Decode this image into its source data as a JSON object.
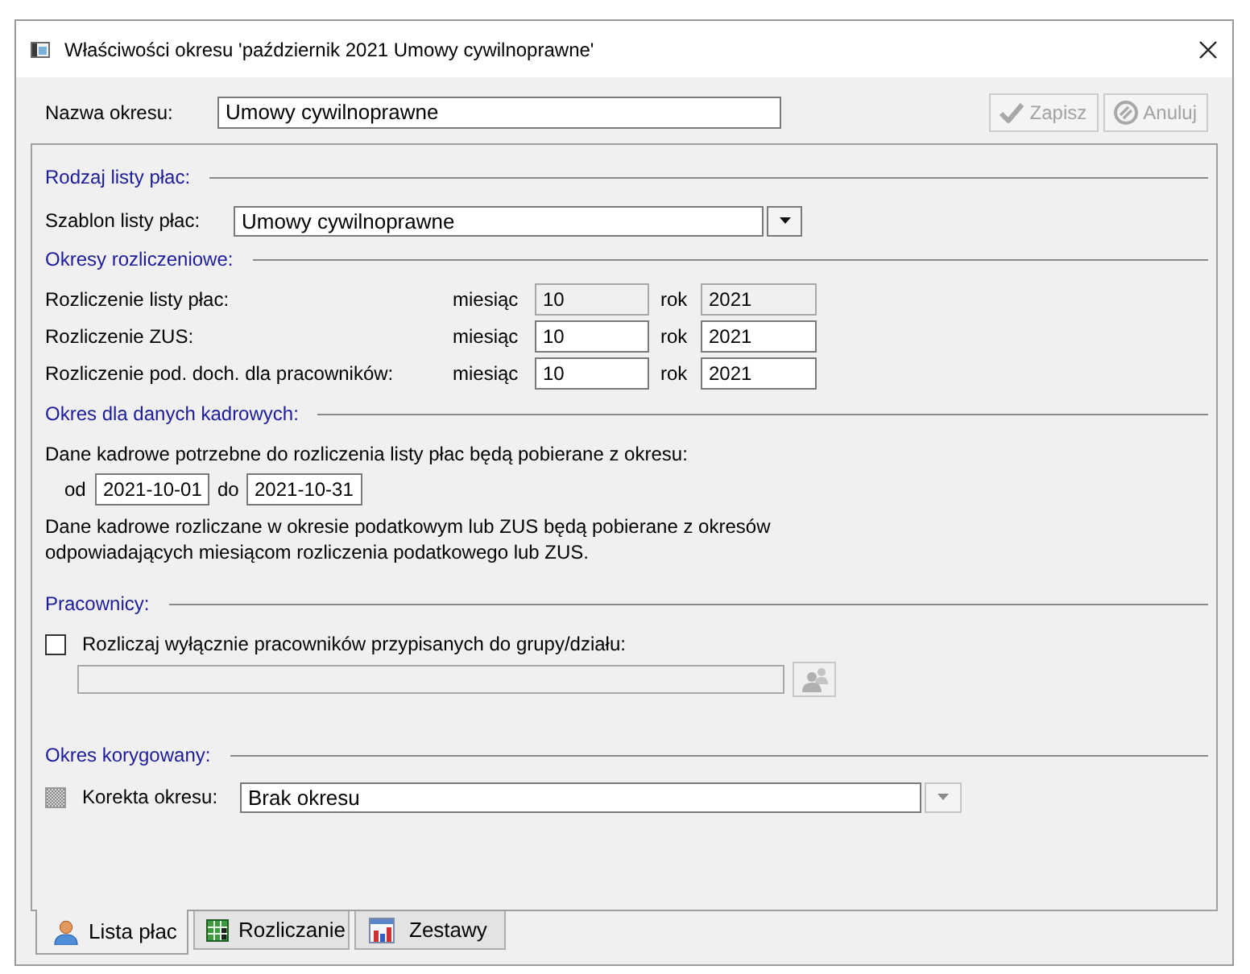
{
  "window": {
    "title": "Właściwości okresu 'październik 2021 Umowy cywilnoprawne'"
  },
  "header": {
    "name_label": "Nazwa okresu:",
    "name_value": "Umowy cywilnoprawne",
    "buttons": [
      {
        "label": "Zapisz",
        "disabled": true
      },
      {
        "label": "Anuluj",
        "disabled": true
      }
    ]
  },
  "payroll_type": {
    "heading": "Rodzaj listy płac:",
    "template_label": "Szablon listy płac:",
    "template_value": "Umowy cywilnoprawne"
  },
  "settlement_periods": {
    "heading": "Okresy rozliczeniowe:",
    "rows": [
      {
        "label": "Rozliczenie listy płac:",
        "month_label": "miesiąc",
        "month": "10",
        "year_label": "rok",
        "year": "2021",
        "disabled": true
      },
      {
        "label": "Rozliczenie ZUS:",
        "month_label": "miesiąc",
        "month": "10",
        "year_label": "rok",
        "year": "2021",
        "disabled": false
      },
      {
        "label": "Rozliczenie pod. doch. dla pracowników:",
        "month_label": "miesiąc",
        "month": "10",
        "year_label": "rok",
        "year": "2021",
        "disabled": false
      }
    ]
  },
  "hr_data_period": {
    "heading": "Okres dla danych kadrowych:",
    "intro": "Dane kadrowe potrzebne do rozliczenia listy płac będą pobierane z okresu:",
    "from_label": "od",
    "from": "2021-10-01",
    "to_label": "do",
    "to": "2021-10-31",
    "note": "Dane kadrowe rozliczane w okresie podatkowym lub ZUS będą pobierane z okresów\nodpowiadających miesiącom rozliczenia podatkowego lub ZUS."
  },
  "employees": {
    "heading": "Pracownicy:",
    "filter_label": "Rozliczaj wyłącznie pracowników przypisanych do grupy/działu:",
    "checked": false,
    "group_field_disabled": true,
    "group_button_disabled": true
  },
  "corrected_period": {
    "heading": "Okres korygowany:",
    "indeterminate": true,
    "label": "Korekta okresu:",
    "value": "Brak okresu",
    "dropdown_disabled": true
  },
  "tabs": [
    {
      "label": "Lista płac",
      "selected": true
    },
    {
      "label": "Rozliczanie",
      "selected": false
    },
    {
      "label": "Zestawy",
      "selected": false
    }
  ]
}
